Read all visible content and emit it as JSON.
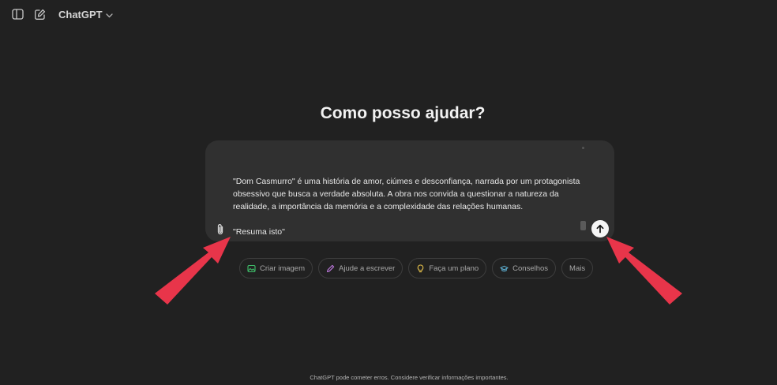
{
  "header": {
    "model_name": "ChatGPT",
    "icons": [
      "sidebar-toggle-icon",
      "new-chat-icon",
      "chevron-down-icon"
    ]
  },
  "hero": {
    "title": "Como posso ajudar?"
  },
  "composer": {
    "pasted_text": "\"Dom Casmurro\" é uma história de amor, ciúmes e desconfiança, narrada por um protagonista obsessivo que busca a verdade absoluta. A obra nos convida a questionar a natureza da realidade, a importância da memória e a complexidade das relações humanas.",
    "prompt": "\"Resuma isto\"",
    "icons": [
      "paperclip-icon",
      "arrow-up-icon"
    ]
  },
  "suggestions": [
    {
      "label": "Criar imagem",
      "icon": "image-icon",
      "color": "#3fbf6a"
    },
    {
      "label": "Ajude a escrever",
      "icon": "pen-icon",
      "color": "#c07ae0"
    },
    {
      "label": "Faça um plano",
      "icon": "lightbulb-icon",
      "color": "#e5c04a"
    },
    {
      "label": "Conselhos",
      "icon": "graduation-cap-icon",
      "color": "#5fb4d8"
    },
    {
      "label": "Mais",
      "icon": "",
      "color": ""
    }
  ],
  "footer": {
    "disclaimer": "ChatGPT pode cometer erros. Considere verificar informações importantes."
  },
  "colors": {
    "background": "#212121",
    "composer": "#303030",
    "annotation_arrow": "#e8354a"
  }
}
